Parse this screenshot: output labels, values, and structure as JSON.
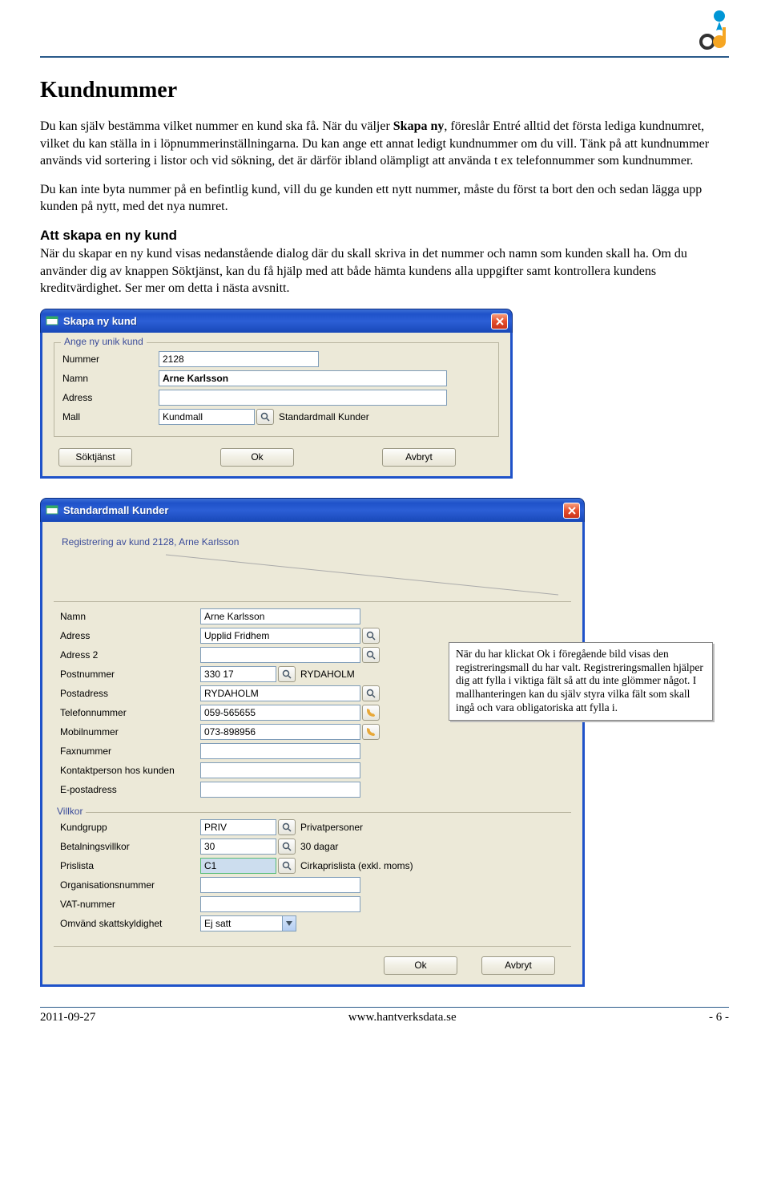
{
  "page": {
    "title": "Kundnummer",
    "p1_a": "Du kan själv bestämma vilket nummer en kund ska få. När du väljer ",
    "p1_bold1": "Skapa ny",
    "p1_b": ", föreslår Entré alltid det första lediga kundnumret, vilket du kan ställa in i löpnummerinställningarna. Du kan ange ett annat ledigt kundnummer om du vill. Tänk på att kundnummer används vid sortering i listor och vid sökning, det är därför ibland olämpligt att använda t ex telefonnummer som kundnummer.",
    "p2": "Du kan inte byta nummer på en befintlig kund, vill du ge kunden ett nytt nummer, måste du först ta bort den och sedan lägga upp kunden på nytt, med det nya numret.",
    "h2": "Att skapa en ny kund",
    "p3": "När du skapar en ny kund visas nedanstående dialog där du skall skriva in det nummer och namn som kunden skall ha. Om du använder dig av knappen Söktjänst, kan du få hjälp med att både hämta kundens alla uppgifter samt kontrollera kundens kreditvärdighet. Ser mer om detta i nästa avsnitt."
  },
  "dialog1": {
    "title": "Skapa ny kund",
    "group": "Ange ny unik kund",
    "labels": {
      "nummer": "Nummer",
      "namn": "Namn",
      "adress": "Adress",
      "mall": "Mall"
    },
    "values": {
      "nummer": "2128",
      "namn": "Arne Karlsson",
      "adress": "",
      "mall": "Kundmall",
      "mall_desc": "Standardmall Kunder"
    },
    "buttons": {
      "soktjanst": "Söktjänst",
      "ok": "Ok",
      "avbryt": "Avbryt"
    }
  },
  "dialog2": {
    "title": "Standardmall Kunder",
    "desc": "Registrering av kund 2128, Arne Karlsson",
    "labels": {
      "namn": "Namn",
      "adress": "Adress",
      "adress2": "Adress 2",
      "postnummer": "Postnummer",
      "postadress": "Postadress",
      "telefon": "Telefonnummer",
      "mobil": "Mobilnummer",
      "fax": "Faxnummer",
      "kontakt": "Kontaktperson hos kunden",
      "epost": "E-postadress",
      "villkor": "Villkor",
      "kundgrupp": "Kundgrupp",
      "betalning": "Betalningsvillkor",
      "prislista": "Prislista",
      "orgnr": "Organisationsnummer",
      "vat": "VAT-nummer",
      "omvand": "Omvänd skattskyldighet"
    },
    "values": {
      "namn": "Arne Karlsson",
      "adress": "Upplid Fridhem",
      "adress2": "",
      "postnummer": "330 17",
      "postnummer_desc": "RYDAHOLM",
      "postadress": "RYDAHOLM",
      "telefon": "059-565655",
      "mobil": "073-898956",
      "fax": "",
      "kontakt": "",
      "epost": "",
      "kundgrupp": "PRIV",
      "kundgrupp_desc": "Privatpersoner",
      "betalning": "30",
      "betalning_desc": "30 dagar",
      "prislista": "C1",
      "prislista_desc": "Cirkaprislista (exkl. moms)",
      "orgnr": "",
      "vat": "",
      "omvand": "Ej satt"
    },
    "buttons": {
      "ok": "Ok",
      "avbryt": "Avbryt"
    }
  },
  "callout": "När du har klickat Ok i föregående bild visas den registreringsmall du har valt. Registreringsmallen hjälper dig att fylla i viktiga fält så att du inte glömmer något. I mallhanteringen kan du själv styra vilka fält som skall ingå och vara obligatoriska att fylla i.",
  "footer": {
    "date": "2011-09-27",
    "url": "www.hantverksdata.se",
    "page": "- 6 -"
  }
}
